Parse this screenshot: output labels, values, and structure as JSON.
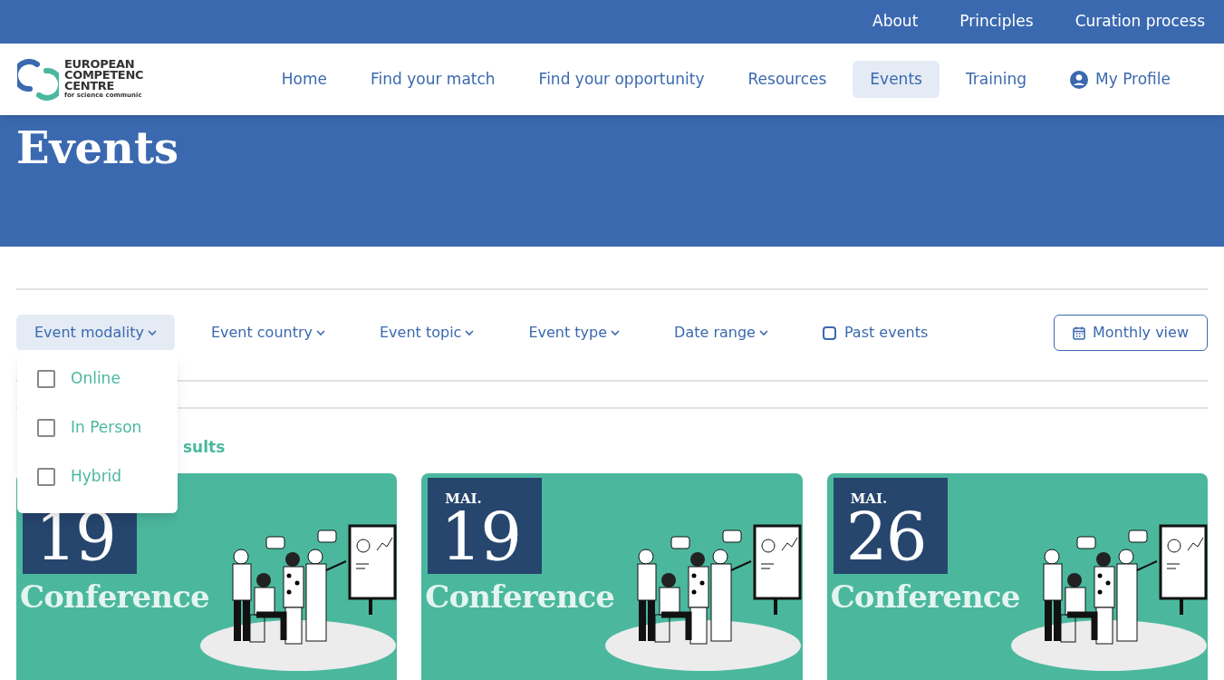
{
  "top_links": [
    "About",
    "Principles",
    "Curation process"
  ],
  "logo": {
    "lines": [
      "EUROPEAN",
      "COMPETENC",
      "CENTRE"
    ],
    "tagline": "for science communic"
  },
  "nav": [
    {
      "label": "Home",
      "selected": false
    },
    {
      "label": "Find your match",
      "selected": false
    },
    {
      "label": "Find your opportunity",
      "selected": false
    },
    {
      "label": "Resources",
      "selected": false
    },
    {
      "label": "Events",
      "selected": true
    },
    {
      "label": "Training",
      "selected": false
    },
    {
      "label": "My Profile",
      "selected": false,
      "kind": "profile"
    }
  ],
  "hero": {
    "title": "Events"
  },
  "filters": [
    {
      "label": "Event modality",
      "kind": "dropdown",
      "expanded": true
    },
    {
      "label": "Event country",
      "kind": "dropdown",
      "expanded": false
    },
    {
      "label": "Event topic",
      "kind": "dropdown",
      "expanded": false
    },
    {
      "label": "Event type",
      "kind": "dropdown",
      "expanded": false
    },
    {
      "label": "Date range",
      "kind": "dropdown",
      "expanded": false
    },
    {
      "label": "Past events",
      "kind": "checkbox",
      "checked": false
    }
  ],
  "view_button": "Monthly view",
  "dropdown_options": [
    {
      "label": "Online",
      "checked": false
    },
    {
      "label": "In Person",
      "checked": false
    },
    {
      "label": "Hybrid",
      "checked": false
    }
  ],
  "results_text": "sults",
  "cards": [
    {
      "day": "19",
      "category": "Conference"
    },
    {
      "month": "MAI.",
      "day": "19",
      "category": "Conference"
    },
    {
      "month": "MAI.",
      "day": "26",
      "category": "Conference"
    }
  ]
}
